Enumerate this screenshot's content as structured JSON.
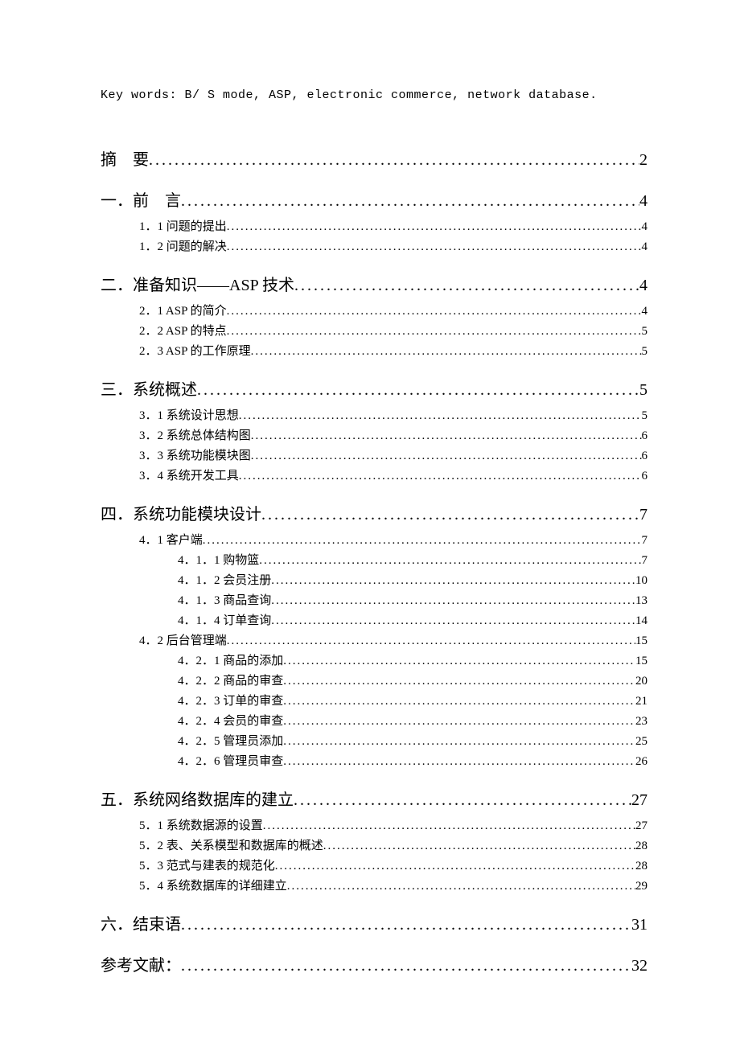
{
  "keywords": "Key words: B/ S mode, ASP, electronic commerce, network database.",
  "toc": [
    {
      "level": 1,
      "title": "摘　要",
      "page": "2"
    },
    {
      "level": 1,
      "title": "一．前　言",
      "page": "4"
    },
    {
      "level": 2,
      "title": "1．1 问题的提出",
      "page": "4"
    },
    {
      "level": 2,
      "title": "1．2 问题的解决",
      "page": "4"
    },
    {
      "level": 1,
      "title": "二．准备知识――ASP 技术",
      "page": "4"
    },
    {
      "level": 2,
      "title": "2．1 ASP 的简介",
      "page": "4"
    },
    {
      "level": 2,
      "title": "2．2 ASP 的特点",
      "page": "5"
    },
    {
      "level": 2,
      "title": "2．3 ASP 的工作原理",
      "page": "5"
    },
    {
      "level": 1,
      "title": "三．系统概述",
      "page": "5"
    },
    {
      "level": 2,
      "title": "3．1 系统设计思想",
      "page": "5"
    },
    {
      "level": 2,
      "title": "3．2 系统总体结构图",
      "page": "6"
    },
    {
      "level": 2,
      "title": "3．3 系统功能模块图",
      "page": "6"
    },
    {
      "level": 2,
      "title": "3．4 系统开发工具",
      "page": "6"
    },
    {
      "level": 1,
      "title": "四．系统功能模块设计",
      "page": "7"
    },
    {
      "level": 2,
      "title": "4．1 客户端",
      "page": "7"
    },
    {
      "level": 3,
      "title": "4．1．1 购物篮",
      "page": "7"
    },
    {
      "level": 3,
      "title": "4．1．2 会员注册",
      "page": "10"
    },
    {
      "level": 3,
      "title": "4．1．3 商品查询",
      "page": "13"
    },
    {
      "level": 3,
      "title": "4．1．4 订单查询",
      "page": "14"
    },
    {
      "level": 2,
      "title": "4．2 后台管理端",
      "page": "15"
    },
    {
      "level": 3,
      "title": "4．2．1 商品的添加",
      "page": "15"
    },
    {
      "level": 3,
      "title": "4．2．2 商品的审查",
      "page": "20"
    },
    {
      "level": 3,
      "title": "4．2．3 订单的审查",
      "page": "21"
    },
    {
      "level": 3,
      "title": "4．2．4 会员的审查",
      "page": "23"
    },
    {
      "level": 3,
      "title": "4．2．5 管理员添加",
      "page": "25"
    },
    {
      "level": 3,
      "title": "4．2．6 管理员审查",
      "page": "26"
    },
    {
      "level": 1,
      "title": "五．系统网络数据库的建立",
      "page": "27"
    },
    {
      "level": 2,
      "title": "5．1 系统数据源的设置",
      "page": "27"
    },
    {
      "level": 2,
      "title": "5．2 表、关系模型和数据库的概述",
      "page": "28"
    },
    {
      "level": 2,
      "title": "5．3 范式与建表的规范化",
      "page": "28"
    },
    {
      "level": 2,
      "title": "5．4 系统数据库的详细建立",
      "page": "29"
    },
    {
      "level": 1,
      "title": "六．结束语",
      "page": "31"
    },
    {
      "level": 1,
      "title": "参考文献：",
      "page": "32"
    }
  ]
}
